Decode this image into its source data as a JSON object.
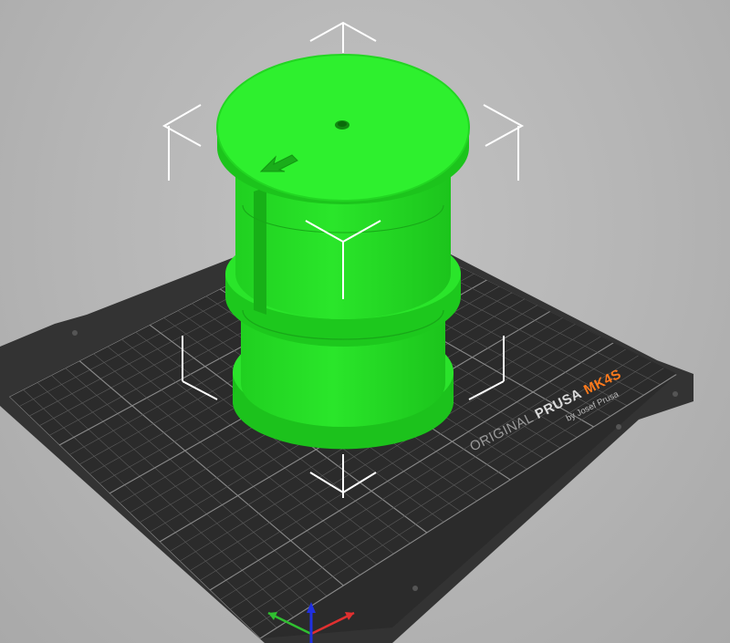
{
  "app": {
    "view": "3D viewport"
  },
  "printer": {
    "brand_prefix": "ORIGINAL",
    "brand": "PRUSA",
    "model": "MK4S",
    "byline": "by Josef Prusa"
  },
  "model": {
    "shape": "barrel",
    "color": "#22dd22",
    "selected": true
  },
  "colors": {
    "background": "#b3b3b3",
    "bed": "#2b2b2b",
    "bed_grid": "#6e6e6e",
    "model": "#22dd22",
    "model_dark": "#17b817",
    "accent_orange": "#ff7a1c",
    "axis_x": "#e03030",
    "axis_y": "#30c030",
    "axis_z": "#2030e0"
  },
  "icons": [
    "move-gizmo-icon",
    "axis-triad-icon"
  ]
}
